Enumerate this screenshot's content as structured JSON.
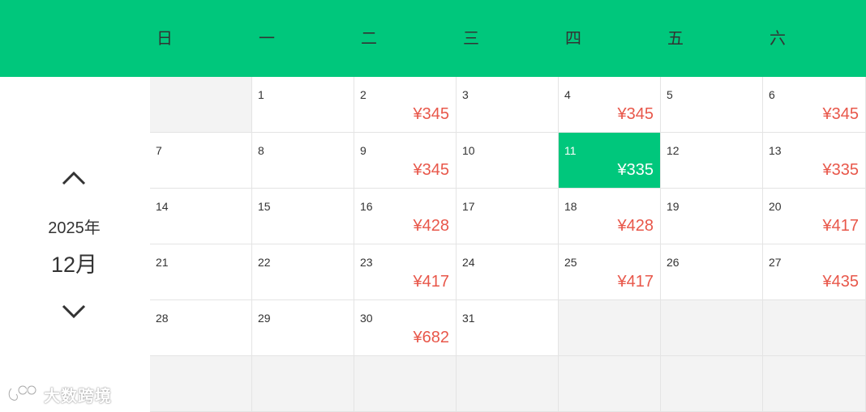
{
  "weekdays": [
    "日",
    "一",
    "二",
    "三",
    "四",
    "五",
    "六"
  ],
  "year_label": "2025年",
  "month_label": "12月",
  "nav": {
    "prev_icon": "chevron-up-icon",
    "next_icon": "chevron-down-icon"
  },
  "colors": {
    "accent": "#00c77c",
    "price": "#e8574a",
    "empty_cell": "#f3f3f3",
    "text": "#333333"
  },
  "selected_day": "11",
  "weeks": [
    [
      {
        "day": "",
        "price": ""
      },
      {
        "day": "1",
        "price": ""
      },
      {
        "day": "2",
        "price": "¥345"
      },
      {
        "day": "3",
        "price": ""
      },
      {
        "day": "4",
        "price": "¥345"
      },
      {
        "day": "5",
        "price": ""
      },
      {
        "day": "6",
        "price": "¥345"
      }
    ],
    [
      {
        "day": "7",
        "price": ""
      },
      {
        "day": "8",
        "price": ""
      },
      {
        "day": "9",
        "price": "¥345"
      },
      {
        "day": "10",
        "price": ""
      },
      {
        "day": "11",
        "price": "¥335"
      },
      {
        "day": "12",
        "price": ""
      },
      {
        "day": "13",
        "price": "¥335"
      }
    ],
    [
      {
        "day": "14",
        "price": ""
      },
      {
        "day": "15",
        "price": ""
      },
      {
        "day": "16",
        "price": "¥428"
      },
      {
        "day": "17",
        "price": ""
      },
      {
        "day": "18",
        "price": "¥428"
      },
      {
        "day": "19",
        "price": ""
      },
      {
        "day": "20",
        "price": "¥417"
      }
    ],
    [
      {
        "day": "21",
        "price": ""
      },
      {
        "day": "22",
        "price": ""
      },
      {
        "day": "23",
        "price": "¥417"
      },
      {
        "day": "24",
        "price": ""
      },
      {
        "day": "25",
        "price": "¥417"
      },
      {
        "day": "26",
        "price": ""
      },
      {
        "day": "27",
        "price": "¥435"
      }
    ],
    [
      {
        "day": "28",
        "price": ""
      },
      {
        "day": "29",
        "price": ""
      },
      {
        "day": "30",
        "price": "¥682"
      },
      {
        "day": "31",
        "price": ""
      },
      {
        "day": "",
        "price": ""
      },
      {
        "day": "",
        "price": ""
      },
      {
        "day": "",
        "price": ""
      }
    ],
    [
      {
        "day": "",
        "price": ""
      },
      {
        "day": "",
        "price": ""
      },
      {
        "day": "",
        "price": ""
      },
      {
        "day": "",
        "price": ""
      },
      {
        "day": "",
        "price": ""
      },
      {
        "day": "",
        "price": ""
      },
      {
        "day": "",
        "price": ""
      }
    ]
  ],
  "watermark": {
    "text": "大数跨境",
    "icon": "brand-logo-icon"
  }
}
